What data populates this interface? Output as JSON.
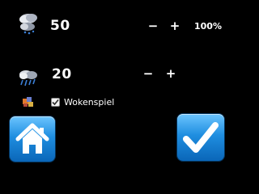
{
  "row1": {
    "icon": "cloud-drizzle-icon",
    "value": "50",
    "minus_label": "−",
    "plus_label": "+",
    "percent": "100%"
  },
  "row2": {
    "icon": "cloud-rain-icon",
    "value": "20",
    "minus_label": "−",
    "plus_label": "+"
  },
  "option": {
    "icon": "cloud-game-icon",
    "checked": true,
    "label": "Wokenspiel"
  },
  "buttons": {
    "home_icon": "home-icon",
    "confirm_icon": "checkmark-icon"
  },
  "colors": {
    "button_top": "#6cc5ff",
    "button_bottom": "#0a66b8",
    "background": "#000000"
  }
}
